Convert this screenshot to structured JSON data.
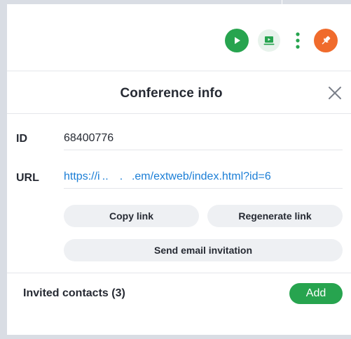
{
  "toolbar": {
    "icons": [
      "play-icon",
      "screen-share-icon",
      "more-vertical-icon",
      "pin-icon"
    ],
    "colors": {
      "primary": "#27a44f",
      "accent": "#f06b2c"
    }
  },
  "panel": {
    "title": "Conference info",
    "id_label": "ID",
    "id_value": "68400776",
    "url_label": "URL",
    "url_value": "https://i ..     .    .em/extweb/index.html?id=6",
    "copy_link": "Copy link",
    "regenerate_link": "Regenerate link",
    "send_email": "Send email invitation",
    "invited_contacts": "Invited contacts (3)",
    "add": "Add"
  }
}
